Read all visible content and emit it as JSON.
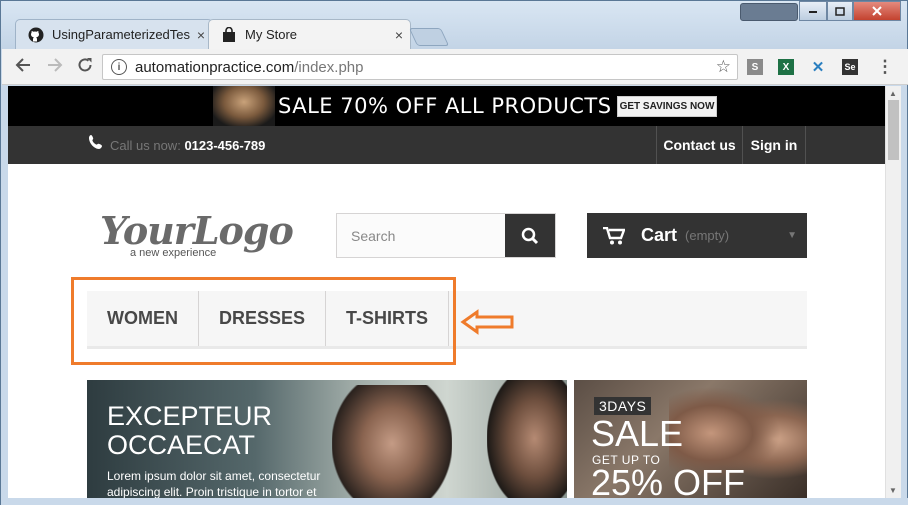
{
  "browser": {
    "tabs": [
      {
        "label": "UsingParameterizedTes",
        "active": false
      },
      {
        "label": "My Store",
        "active": true
      }
    ],
    "close_glyph": "×",
    "url_host": "automationpractice.com",
    "url_path": "/index.php",
    "extensions": [
      {
        "name": "s-extension-icon",
        "glyph": "S",
        "color": "#8a8a8a"
      },
      {
        "name": "excel-extension-icon",
        "glyph": "X",
        "color": "#1e7145"
      },
      {
        "name": "tools-extension-icon",
        "glyph": "✕",
        "color": "#2a7fc0"
      },
      {
        "name": "selenium-extension-icon",
        "glyph": "Se",
        "color": "#333333"
      }
    ]
  },
  "store": {
    "banner": {
      "text": "SALE 70% OFF ALL PRODUCTS",
      "button": "GET SAVINGS NOW"
    },
    "topnav": {
      "call_prefix": "Call us now:",
      "phone": "0123-456-789",
      "links": [
        "Contact us",
        "Sign in"
      ]
    },
    "logo": {
      "text": "YourLogo",
      "tagline": "a new experience"
    },
    "search": {
      "placeholder": "Search"
    },
    "cart": {
      "label": "Cart",
      "status": "(empty)"
    },
    "menu": [
      "WOMEN",
      "DRESSES",
      "T-SHIRTS"
    ],
    "slider": {
      "title_line1": "EXCEPTEUR",
      "title_line2": "OCCAECAT",
      "text": "Lorem ipsum dolor sit amet, consectetur adipiscing elit. Proin tristique in tortor et"
    },
    "promo": {
      "days": "3DAYS",
      "sale": "SALE",
      "getup": "GET UP TO",
      "pct": "25% OFF"
    }
  },
  "colors": {
    "highlight": "#ef7b2b",
    "dark": "#333333"
  }
}
